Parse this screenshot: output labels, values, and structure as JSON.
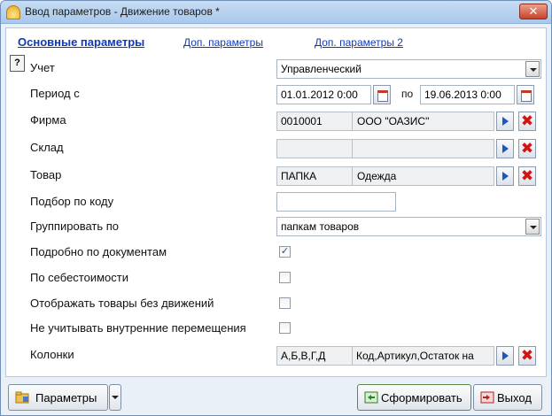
{
  "window": {
    "title": "Ввод параметров - Движение товаров *",
    "close_symbol": "✕"
  },
  "tabs": [
    {
      "label": "Основные параметры",
      "active": true
    },
    {
      "label": "Доп. параметры",
      "active": false
    },
    {
      "label": "Доп. параметры 2",
      "active": false
    }
  ],
  "help_button": {
    "symbol": "?"
  },
  "form": {
    "uchet": {
      "label": "Учет",
      "value": "Управленческий"
    },
    "period": {
      "label": "Период с",
      "from": "01.01.2012 0:00",
      "to_label": "по",
      "to": "19.06.2013 0:00"
    },
    "firma": {
      "label": "Фирма",
      "code": "0010001",
      "name": "ООО \"ОАЗИС\""
    },
    "sklad": {
      "label": "Склад",
      "code": "",
      "name": ""
    },
    "tovar": {
      "label": "Товар",
      "code": "ПАПКА",
      "name": "Одежда"
    },
    "podbor": {
      "label": "Подбор по коду",
      "value": ""
    },
    "gruppirovat": {
      "label": "Группировать по",
      "value": "папкам товаров"
    },
    "podrobno": {
      "label": "Подробно по документам",
      "checked": true
    },
    "sebestoimost": {
      "label": "По себестоимости",
      "checked": false
    },
    "bez_dvizheniy": {
      "label": "Отображать товары без движений",
      "checked": false
    },
    "vnutrennie": {
      "label": "Не учитывать внутренние перемещения",
      "checked": false
    },
    "kolonki": {
      "label": "Колонки",
      "code": "А,Б,В,Г,Д",
      "name": "Код,Артикул,Остаток на"
    }
  },
  "clear_symbol": "✖",
  "check_symbol": "✓",
  "bottom": {
    "params_label": "Параметры",
    "form_label": "Сформировать",
    "exit_label": "Выход"
  }
}
